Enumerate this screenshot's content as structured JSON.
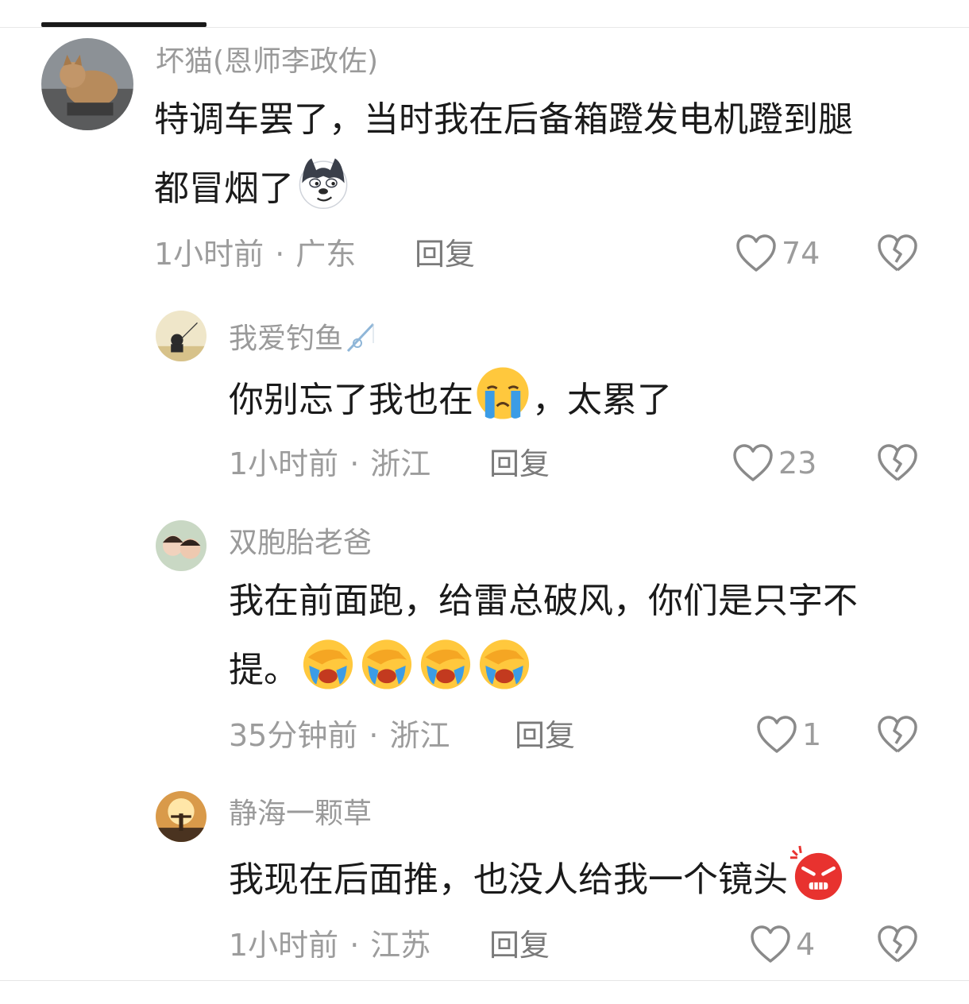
{
  "comments": [
    {
      "username": "坏猫(恩师李政佐)",
      "text_line1": "特调车罢了，当时我在后备箱蹬发电机蹬到腿",
      "text_line2": "都冒烟了",
      "emoji": "husky-smirk-emoji",
      "time": "1小时前",
      "location": "广东",
      "reply_label": "回复",
      "likes": "74"
    },
    {
      "username": "我爱钓鱼",
      "username_emoji": "fishing-rod-emoji",
      "text_before": "你别忘了我也在",
      "emoji": "crying-emoji",
      "text_after": "，太累了",
      "time": "1小时前",
      "location": "浙江",
      "reply_label": "回复",
      "likes": "23"
    },
    {
      "username": "双胞胎老爸",
      "text_line1": "我在前面跑，给雷总破风，你们是只字不",
      "text_line2": "提。",
      "emoji": "facepalm-cry-emoji",
      "emoji_count": 4,
      "time": "35分钟前",
      "location": "浙江",
      "reply_label": "回复",
      "likes": "1"
    },
    {
      "username": "静海一颗草",
      "text": "我现在后面推，也没人给我一个镜头",
      "emoji": "angry-face-emoji",
      "time": "1小时前",
      "location": "江苏",
      "reply_label": "回复",
      "likes": "4"
    }
  ],
  "meta_separator": "·",
  "colors": {
    "text": "#1a1a1a",
    "muted": "#9c9c9c",
    "username": "#9a9a9a"
  }
}
